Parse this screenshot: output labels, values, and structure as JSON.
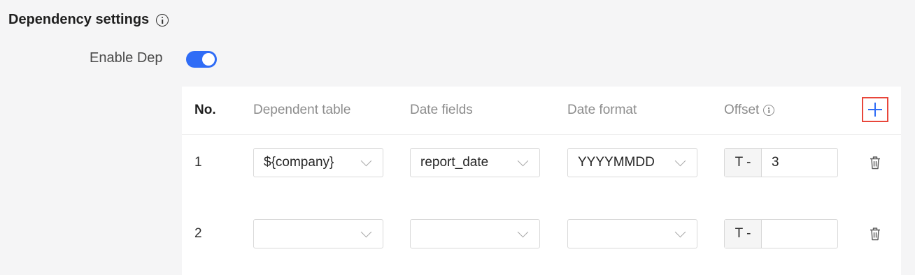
{
  "section": {
    "title": "Dependency settings",
    "info_icon": "info-circle-icon"
  },
  "enable": {
    "label": "Enable Dep",
    "checked": true,
    "color": "#2f6cf6"
  },
  "table": {
    "headers": {
      "no": "No.",
      "dependent_table": "Dependent table",
      "date_fields": "Date fields",
      "date_format": "Date format",
      "offset": "Offset"
    },
    "add_icon": "plus-icon",
    "rows": [
      {
        "no": "1",
        "dependent_table": "${company}",
        "date_fields": "report_date",
        "date_format": "YYYYMMDD",
        "offset_prefix": "T -",
        "offset_value": "3",
        "delete_icon": "trash-icon"
      },
      {
        "no": "2",
        "dependent_table": "",
        "date_fields": "",
        "date_format": "",
        "offset_prefix": "T -",
        "offset_value": "",
        "delete_icon": "trash-icon"
      }
    ]
  },
  "colors": {
    "accent": "#2f6cf6",
    "highlight_border": "#e8463a"
  }
}
